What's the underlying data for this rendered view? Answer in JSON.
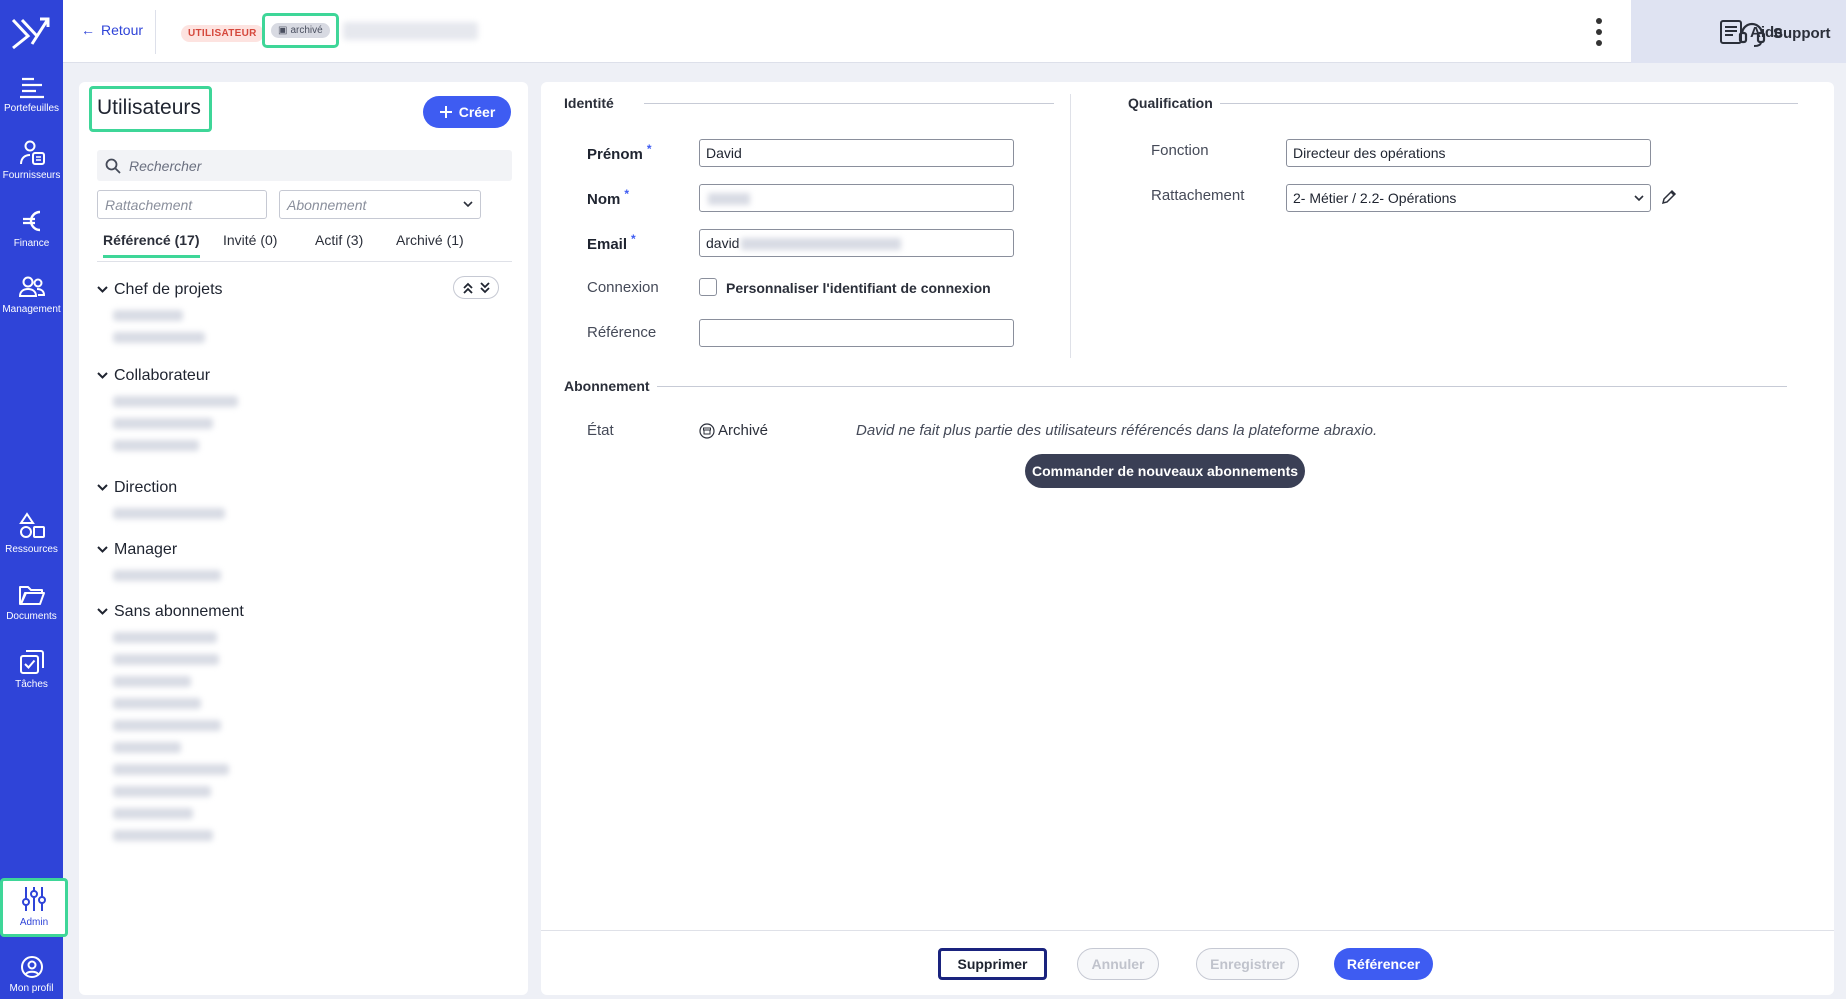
{
  "header": {
    "back_label": "Retour",
    "role_badge": "UTILISATEUR",
    "status_badge": "archivé",
    "help_label": "Aide",
    "support_label": "Support"
  },
  "sidebar": {
    "items": [
      {
        "label": "Portefeuilles",
        "icon": "portfolio-icon"
      },
      {
        "label": "Fournisseurs",
        "icon": "suppliers-icon"
      },
      {
        "label": "Finance",
        "icon": "euro-icon"
      },
      {
        "label": "Management",
        "icon": "people-icon"
      },
      {
        "label": "Ressources",
        "icon": "shapes-icon"
      },
      {
        "label": "Documents",
        "icon": "folder-icon"
      },
      {
        "label": "Tâches",
        "icon": "tasks-icon"
      },
      {
        "label": "Admin",
        "icon": "sliders-icon"
      },
      {
        "label": "Mon profil",
        "icon": "user-circle-icon"
      }
    ]
  },
  "users_panel": {
    "title": "Utilisateurs",
    "create_label": "Créer",
    "search_placeholder": "Rechercher",
    "filter_rattachement": "Rattachement",
    "filter_abonnement": "Abonnement",
    "tabs": [
      {
        "label": "Référencé (17)",
        "active": true
      },
      {
        "label": "Invité (0)",
        "active": false
      },
      {
        "label": "Actif (3)",
        "active": false
      },
      {
        "label": "Archivé (1)",
        "active": false
      }
    ],
    "groups": [
      {
        "name": "Chef de projets"
      },
      {
        "name": "Collaborateur"
      },
      {
        "name": "Direction"
      },
      {
        "name": "Manager"
      },
      {
        "name": "Sans abonnement"
      }
    ]
  },
  "form": {
    "identity_title": "Identité",
    "qualification_title": "Qualification",
    "subscription_title": "Abonnement",
    "labels": {
      "firstname": "Prénom",
      "lastname": "Nom",
      "email": "Email",
      "connexion": "Connexion",
      "reference": "Référence",
      "fonction": "Fonction",
      "rattachement": "Rattachement",
      "etat": "État"
    },
    "values": {
      "firstname": "David",
      "email_prefix": "david",
      "fonction": "Directeur des opérations",
      "rattachement": "2- Métier / 2.2- Opérations",
      "reference": ""
    },
    "required_mark": "*",
    "custom_login_label": "Personnaliser l'identifiant de connexion",
    "state_value": "Archivé",
    "state_note": "David ne fait plus partie des utilisateurs référencés dans la plateforme abraxio.",
    "order_button": "Commander de nouveaux abonnements"
  },
  "footer": {
    "delete": "Supprimer",
    "cancel": "Annuler",
    "save": "Enregistrer",
    "reference": "Référencer"
  },
  "colors": {
    "brand": "#2f44d8",
    "primary_button": "#3e5cf2",
    "highlight": "#3ed698",
    "dark_button": "#3a3f55"
  }
}
